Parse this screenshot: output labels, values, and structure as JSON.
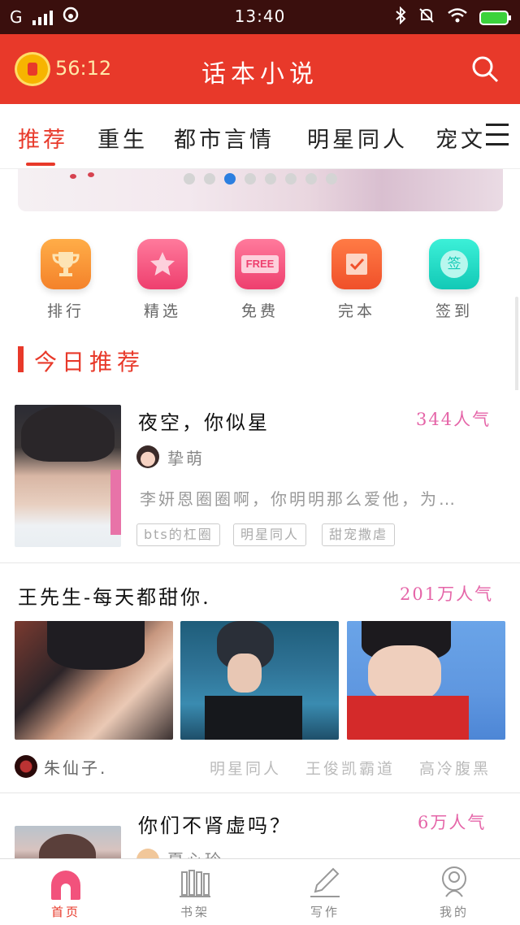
{
  "status_bar": {
    "carrier": "G",
    "time": "13:40"
  },
  "header": {
    "timer": "56:12",
    "title": "话本小说"
  },
  "tabs": [
    {
      "label": "推荐",
      "active": true
    },
    {
      "label": "重生"
    },
    {
      "label": "都市言情"
    },
    {
      "label": "明星同人"
    },
    {
      "label": "宠文"
    }
  ],
  "banner": {
    "dots": 8,
    "active_dot": 3
  },
  "quick_links": [
    {
      "label": "排行",
      "icon": "trophy-icon",
      "color": "#f7892c"
    },
    {
      "label": "精选",
      "icon": "star-icon",
      "color": "#f2527c"
    },
    {
      "label": "免费",
      "icon": "free-icon",
      "color": "#f2527c",
      "badge": "FREE"
    },
    {
      "label": "完本",
      "icon": "check-icon",
      "color": "#f5562b"
    },
    {
      "label": "签到",
      "icon": "sign-in-icon",
      "color": "#1ad9c2",
      "badge": "签"
    }
  ],
  "section_title": "今日推荐",
  "books": [
    {
      "title": "夜空，你似星",
      "popularity": "344人气",
      "author": "挚萌",
      "description": "李妍恩圈圈啊，你明明那么爱他，为…",
      "tags": [
        "bts的杠圈",
        "明星同人",
        "甜宠撒虐"
      ]
    },
    {
      "title": "王先生-每天都甜你.",
      "popularity": "201万人气",
      "author": "朱仙子.",
      "tags": [
        "明星同人",
        "王俊凯霸道",
        "高冷腹黑"
      ]
    },
    {
      "title": "你们不肾虚吗？",
      "popularity": "6万人气",
      "author": "夏心玲"
    }
  ],
  "bottom_nav": [
    {
      "label": "首页",
      "icon": "home-icon",
      "active": true
    },
    {
      "label": "书架",
      "icon": "bookshelf-icon"
    },
    {
      "label": "写作",
      "icon": "write-icon"
    },
    {
      "label": "我的",
      "icon": "profile-icon"
    }
  ],
  "colors": {
    "brand_red": "#e8392a",
    "popularity_pink": "#e565a8",
    "active_dot": "#2c7fe0"
  }
}
